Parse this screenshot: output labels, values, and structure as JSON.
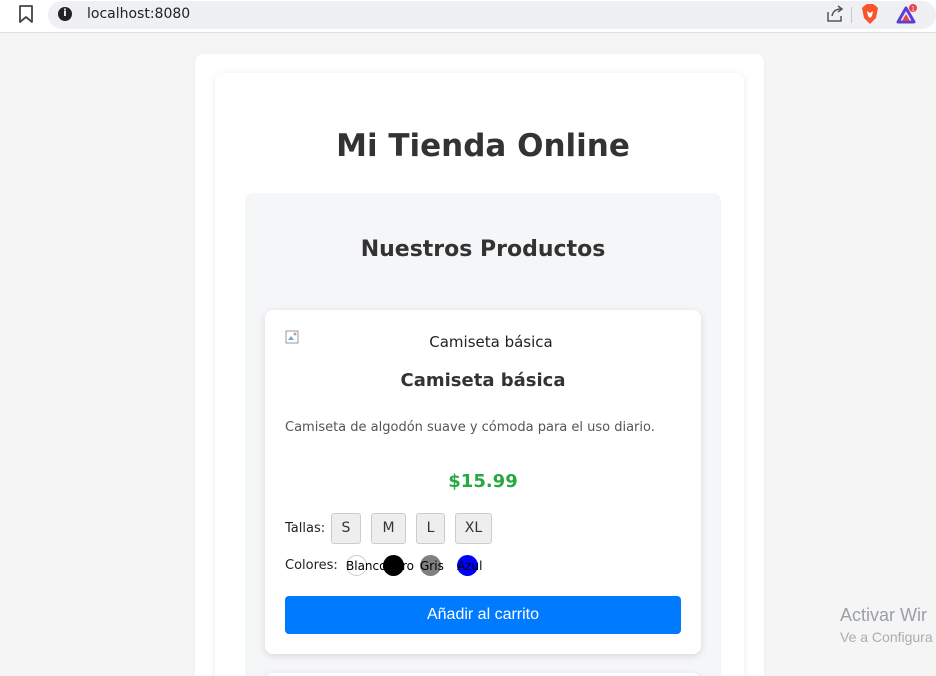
{
  "browser": {
    "url": "localhost:8080",
    "rewards_badge": "1"
  },
  "page": {
    "title": "Mi Tienda Online",
    "section_title": "Nuestros Productos"
  },
  "product": {
    "image_alt": "Camiseta básica",
    "name": "Camiseta básica",
    "description": "Camiseta de algodón suave y cómoda para el uso diario.",
    "price": "$15.99",
    "sizes_label": "Tallas:",
    "sizes": [
      "S",
      "M",
      "L",
      "XL"
    ],
    "colors_label": "Colores:",
    "colors": [
      {
        "label": "Blanco",
        "hex": "#ffffff"
      },
      {
        "label": "Negro",
        "hex": "#000000"
      },
      {
        "label": "Gris",
        "hex": "#808080"
      },
      {
        "label": "Azul",
        "hex": "#0000ff"
      }
    ],
    "add_button": "Añadir al carrito"
  },
  "windows_watermark": {
    "title": "Activar Wir",
    "subtitle": "Ve a Configura"
  },
  "theme": {
    "accent": "#007bff",
    "price_color": "#28a745"
  }
}
